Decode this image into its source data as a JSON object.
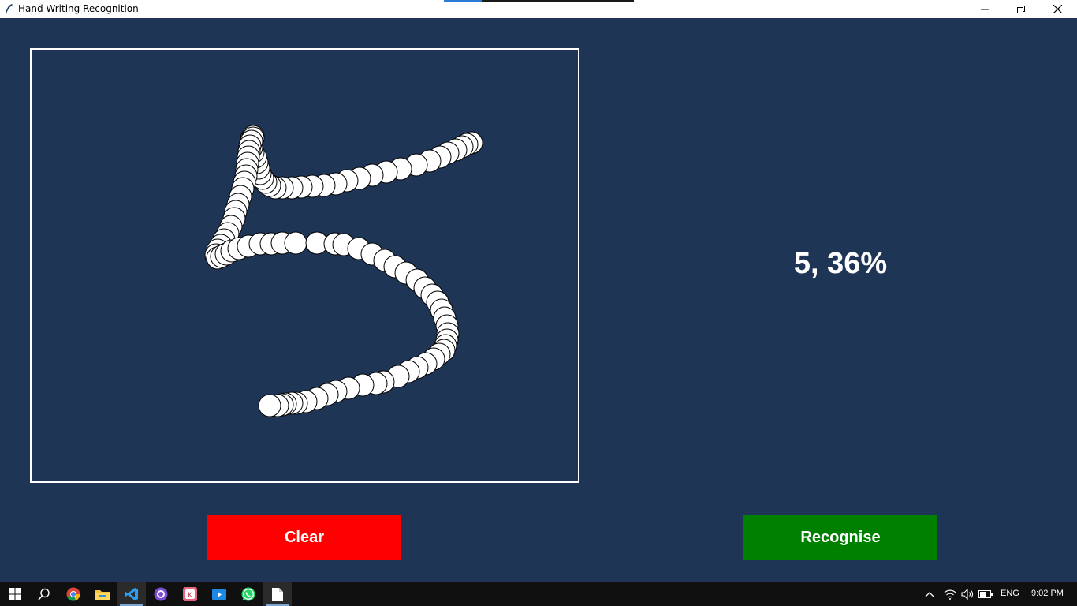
{
  "window": {
    "title": "Hand Writing Recognition"
  },
  "prediction": {
    "text": "5, 36%"
  },
  "buttons": {
    "clear_label": "Clear",
    "recognise_label": "Recognise"
  },
  "colors": {
    "background": "#1f3556",
    "clear": "#ff0000",
    "recognise": "#008000",
    "stroke_fill": "#ffffff",
    "stroke_outline": "#000000"
  },
  "taskbar": {
    "apps": [
      "windows-start-icon",
      "search-icon",
      "chrome-icon",
      "file-explorer-icon",
      "vscode-icon",
      "github-desktop-icon",
      "sketch-app-icon",
      "media-player-icon",
      "whatsapp-icon",
      "notepad-icon"
    ],
    "language": "ENG",
    "time": "9:02 PM"
  }
}
